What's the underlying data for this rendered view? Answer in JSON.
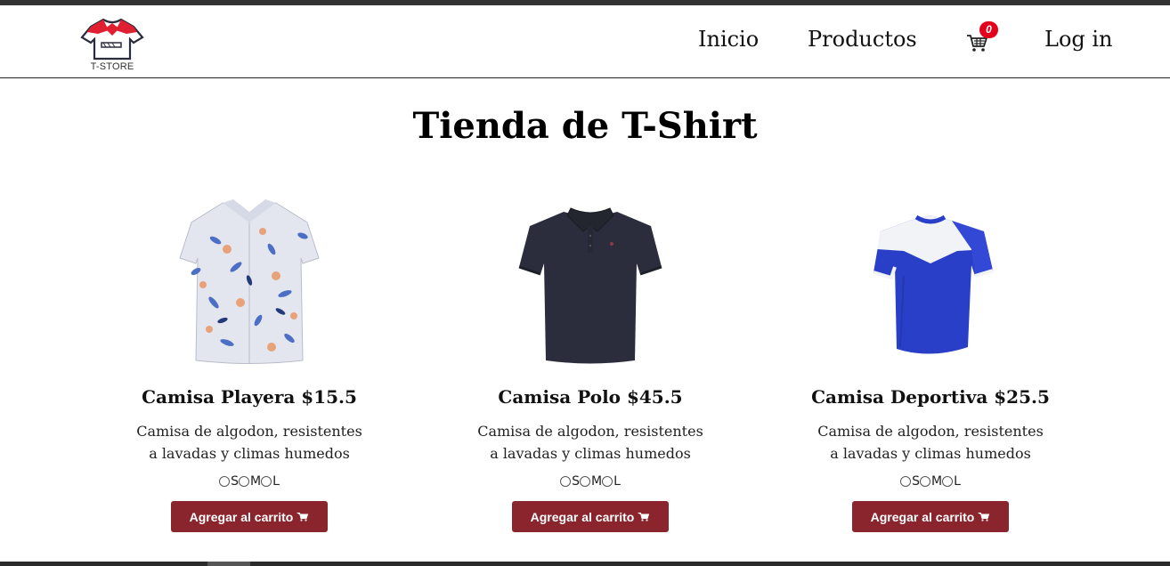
{
  "header": {
    "logo_text": "T-STORE",
    "nav": {
      "inicio": "Inicio",
      "productos": "Productos",
      "login": "Log in"
    },
    "cart_count": "0"
  },
  "page_title": "Tienda de T-Shirt",
  "products": [
    {
      "name": "Camisa Playera $15.5",
      "description": "Camisa de algodon, resistentes a lavadas y climas humedos",
      "sizes": [
        "S",
        "M",
        "L"
      ],
      "button_label": "Agregar al carrito",
      "image": "floral-shirt"
    },
    {
      "name": "Camisa Polo $45.5",
      "description": "Camisa de algodon, resistentes a lavadas y climas humedos",
      "sizes": [
        "S",
        "M",
        "L"
      ],
      "button_label": "Agregar al carrito",
      "image": "navy-polo-shirt"
    },
    {
      "name": "Camisa Deportiva $25.5",
      "description": "Camisa de algodon, resistentes a lavadas y climas humedos",
      "sizes": [
        "S",
        "M",
        "L"
      ],
      "button_label": "Agregar al carrito",
      "image": "blue-sport-jersey"
    }
  ],
  "colors": {
    "button": "#8b252d",
    "badge": "#e3001b",
    "logo_red": "#e02030",
    "jersey_blue": "#2a3fc8",
    "polo_navy": "#2b2d3c"
  }
}
